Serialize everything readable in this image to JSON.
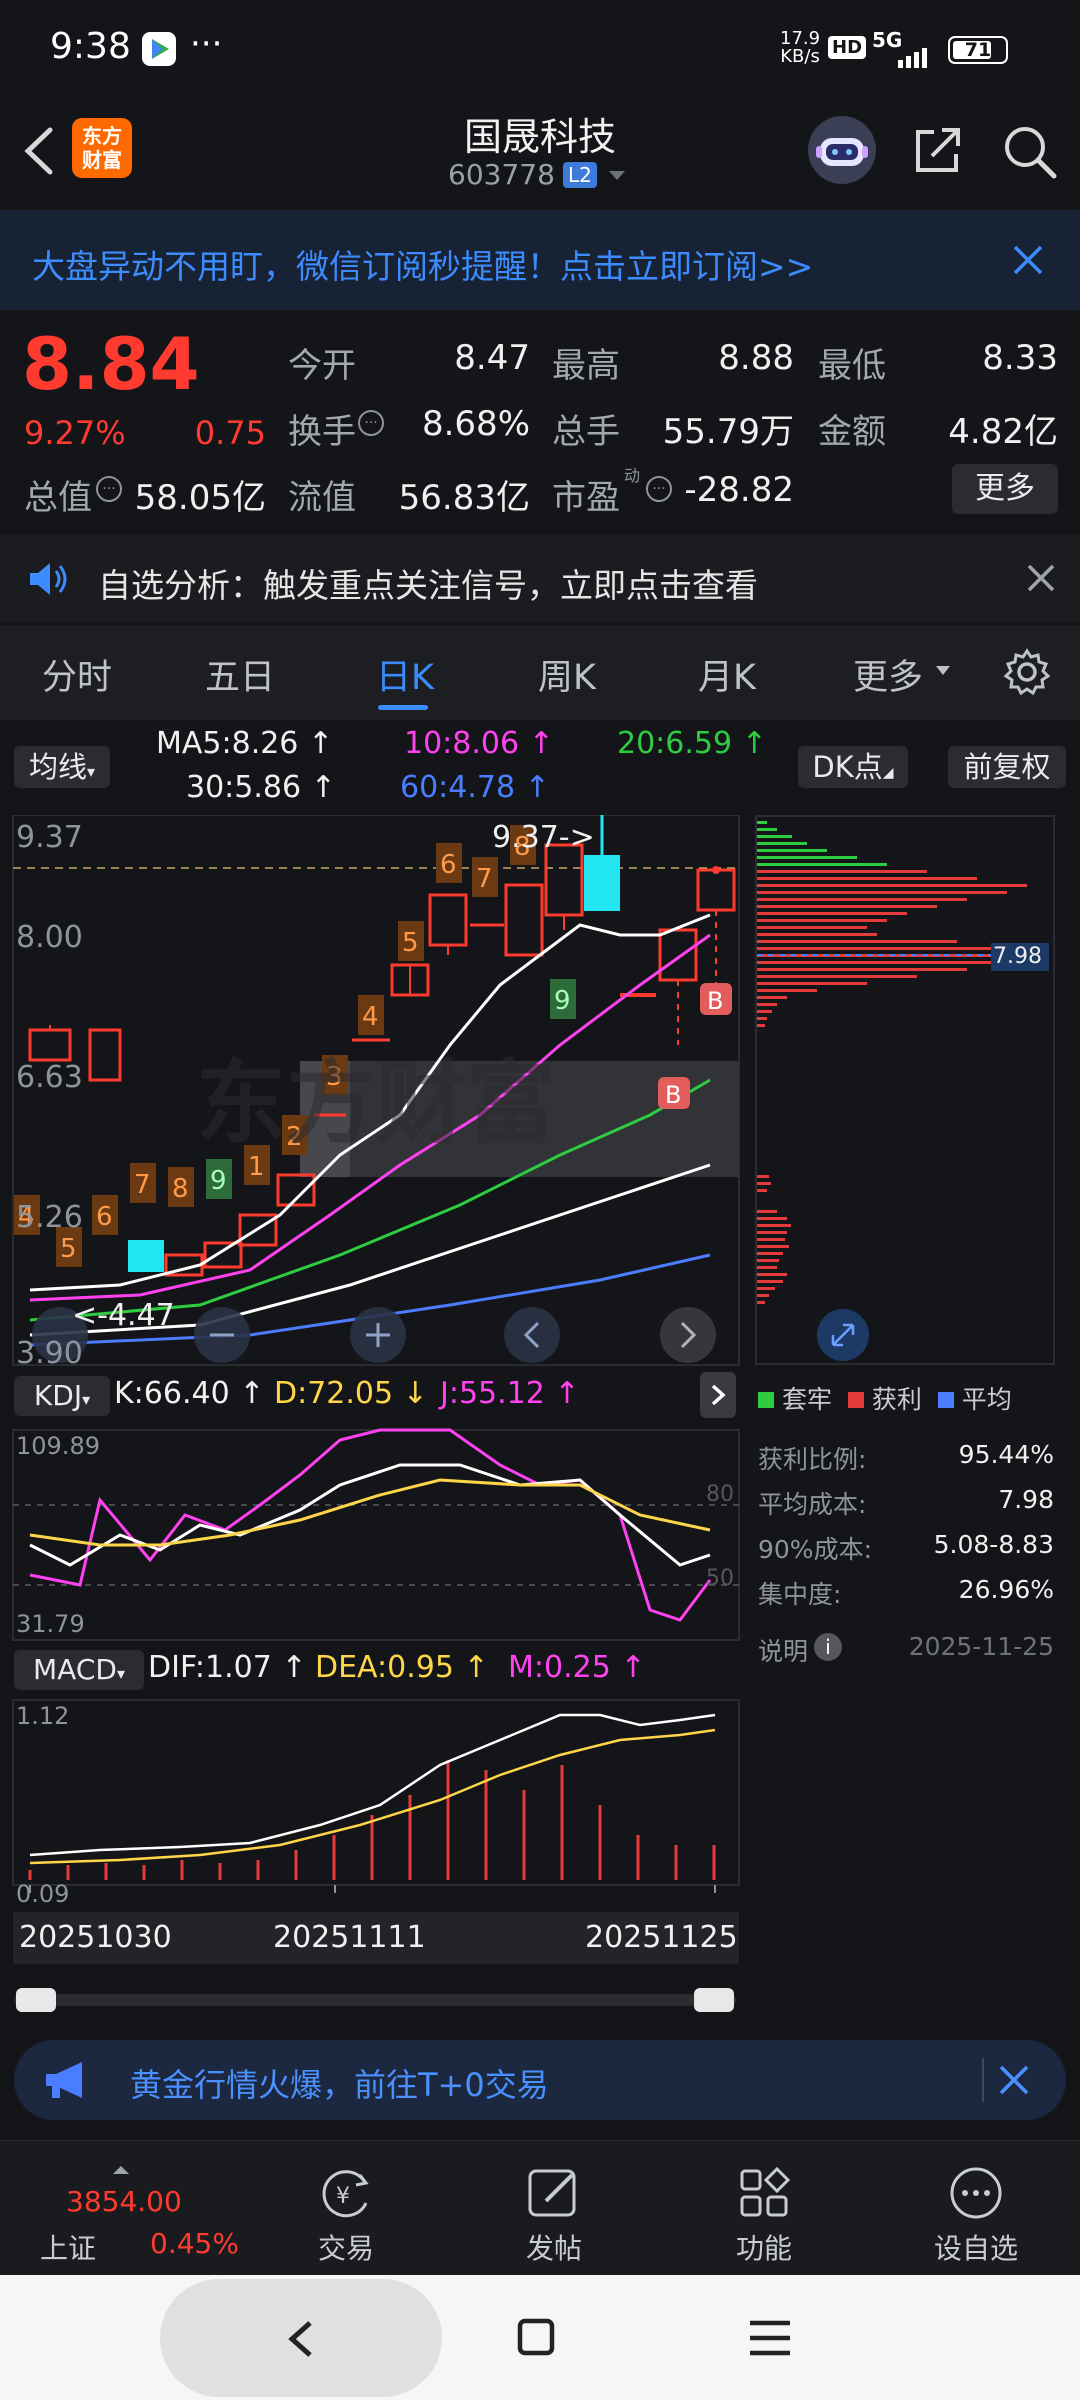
{
  "status": {
    "time": "9:38",
    "speed": "17.9",
    "speed_unit": "KB/s",
    "hd": "HD",
    "network": "5G",
    "battery": "71"
  },
  "header": {
    "logo_line1": "东方",
    "logo_line2": "财富",
    "title": "国晟科技",
    "code": "603778",
    "level": "L2"
  },
  "banner": {
    "text": "大盘异动不用盯，微信订阅秒提醒！点击立即订阅>>"
  },
  "quote": {
    "price": "8.84",
    "change_pct": "9.27%",
    "change": "0.75",
    "open_label": "今开",
    "open": "8.47",
    "high_label": "最高",
    "high": "8.88",
    "low_label": "最低",
    "low": "8.33",
    "turnover_label": "换手",
    "turnover": "8.68%",
    "volume_label": "总手",
    "volume": "55.79万",
    "amount_label": "金额",
    "amount": "4.82亿",
    "mktcap_label": "总值",
    "mktcap": "58.05亿",
    "float_label": "流值",
    "float": "56.83亿",
    "pe_label": "市盈",
    "pe_sup": "动",
    "pe": "-28.82",
    "more": "更多"
  },
  "notice": {
    "text": "自选分析：触发重点关注信号，立即点击查看"
  },
  "tabs": [
    "分时",
    "五日",
    "日K",
    "周K",
    "月K",
    "更多"
  ],
  "chart": {
    "ma_selector": "均线",
    "ma5": "MA5:8.26",
    "ma10": "10:8.06",
    "ma20": "20:6.59",
    "ma30": "30:5.86",
    "ma60": "60:4.78",
    "dk_button": "DK点",
    "adjust_button": "前复权",
    "price_ticks": [
      "9.37",
      "8.00",
      "6.63",
      "5.26",
      "3.90"
    ],
    "high_marker": "9.37->",
    "low_marker": "<-4.47",
    "watermark": "东方财富",
    "cost_price": "7.98",
    "kdj_selector": "KDJ",
    "kdj_k": "K:66.40",
    "kdj_d": "D:72.05",
    "kdj_j": "J:55.12",
    "kdj_top": "109.89",
    "kdj_bottom": "31.79",
    "kdj_80": "80",
    "kdj_50": "50",
    "macd_selector": "MACD",
    "macd_dif": "DIF:1.07",
    "macd_dea": "DEA:0.95",
    "macd_m": "M:0.25",
    "macd_top": "1.12",
    "macd_bottom": "0.09",
    "dates": [
      "20251030",
      "20251111",
      "20251125"
    ]
  },
  "chips": {
    "legend": [
      "套牢",
      "获利",
      "平均"
    ],
    "profit_label": "获利比例:",
    "profit": "95.44%",
    "avg_label": "平均成本:",
    "avg": "7.98",
    "c90_label": "90%成本:",
    "c90": "5.08-8.83",
    "conc_label": "集中度:",
    "conc": "26.96%",
    "note_label": "说明",
    "date": "2025-11-25"
  },
  "promo": {
    "text": "黄金行情火爆，前往T+0交易"
  },
  "dock": {
    "index_value": "3854.00",
    "index_name": "上证",
    "index_change": "0.45%",
    "items": [
      "交易",
      "发帖",
      "功能",
      "设自选"
    ]
  },
  "colors": {
    "up": "#ff3b30",
    "down": "#2ecc40",
    "accent": "#3c8cff",
    "cyan": "#21e6f2",
    "ma5": "#ffffff",
    "ma10": "#ff42f0",
    "ma20": "#2ecc40",
    "ma30": "#ffffff",
    "ma60": "#4a7dff"
  }
}
